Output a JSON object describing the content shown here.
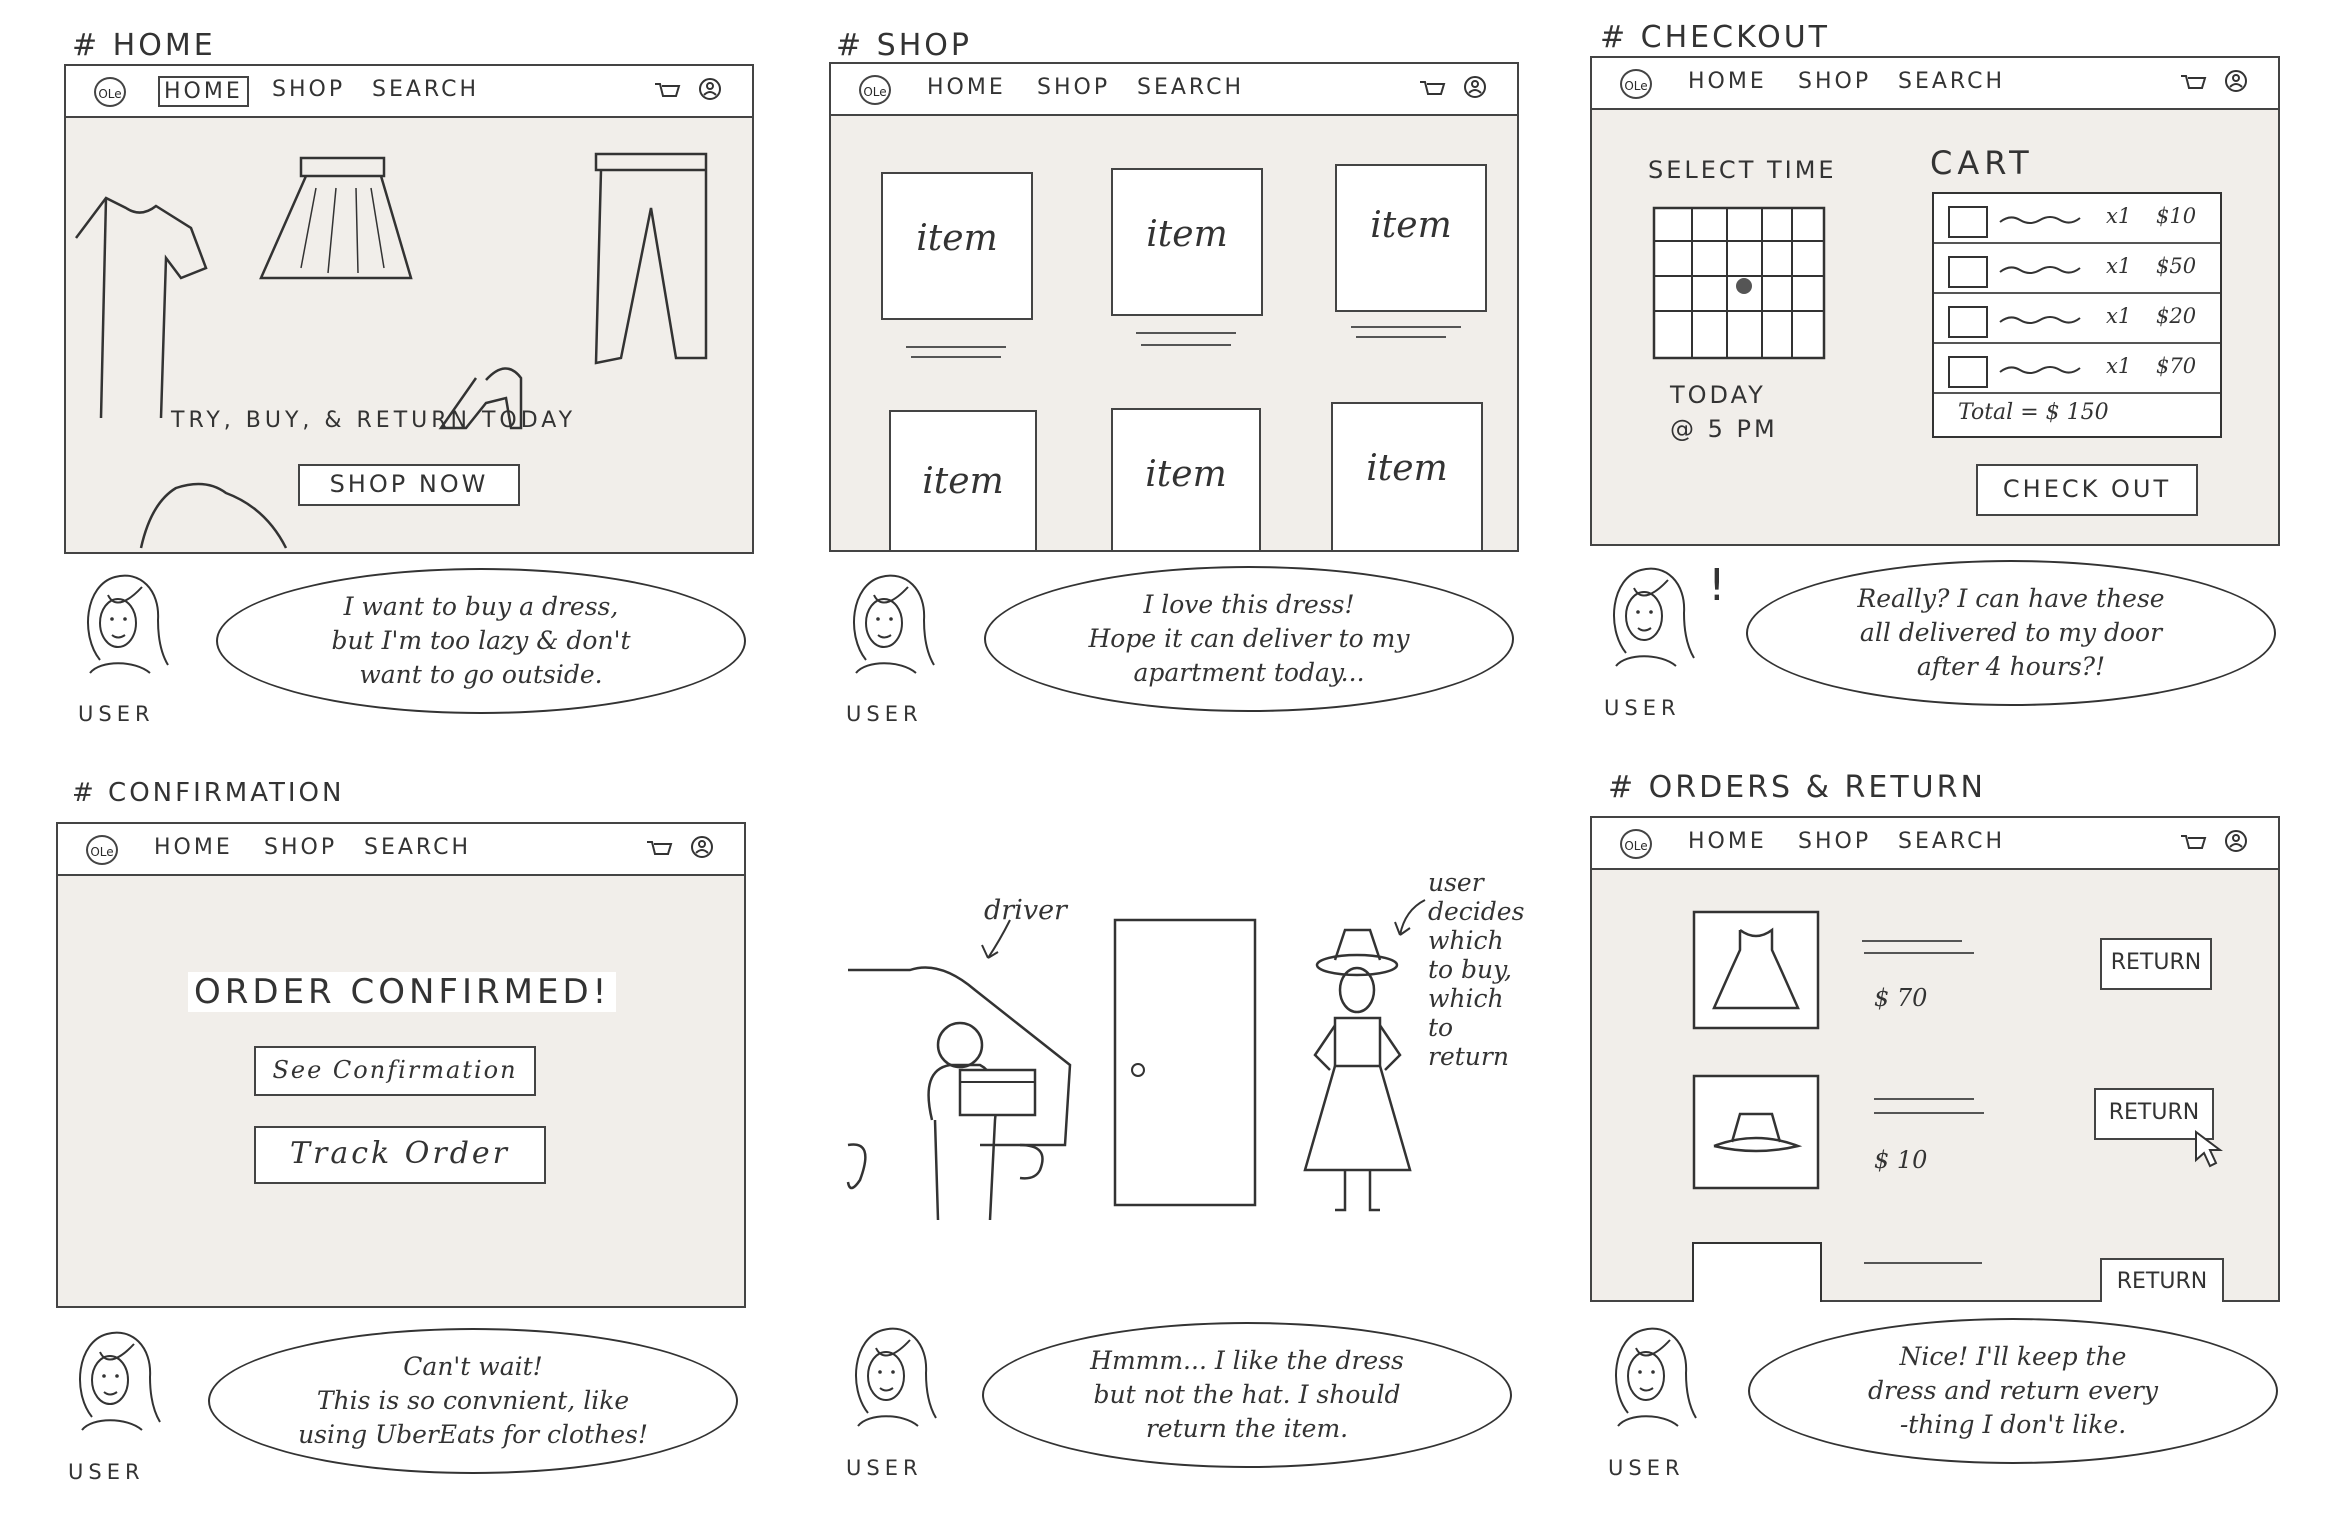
{
  "nav": {
    "logo": "OLe",
    "home": "HOME",
    "shop": "SHOP",
    "search": "SEARCH"
  },
  "user_label": "USER",
  "home": {
    "title": "# HOME",
    "tagline": "TRY, BUY, & RETURN TODAY",
    "cta": "SHOP NOW",
    "speech": "I want to buy a dress,\nbut I'm too lazy & don't\nwant to go outside."
  },
  "shop": {
    "title": "# SHOP",
    "items": [
      "item",
      "item",
      "item",
      "item",
      "item",
      "item"
    ],
    "speech": "I love this dress!\nHope it can deliver to my\napartment today..."
  },
  "checkout": {
    "title": "# CHECKOUT",
    "select_time": "SELECT TIME",
    "time_value": "TODAY\n@ 5 PM",
    "cart_title": "CART",
    "cart_items": [
      {
        "qty": "x1",
        "price": "$10"
      },
      {
        "qty": "x1",
        "price": "$50"
      },
      {
        "qty": "x1",
        "price": "$20"
      },
      {
        "qty": "x1",
        "price": "$70"
      }
    ],
    "total": "Total = $ 150",
    "button": "CHECK OUT",
    "exclaim": "!",
    "speech": "Really? I can have these\nall delivered to my door\nafter 4 hours?!"
  },
  "confirmation": {
    "title": "# CONFIRMATION",
    "heading": "ORDER CONFIRMED!",
    "see_btn": "See Confirmation",
    "track_btn": "Track Order",
    "speech": "Can't wait!\nThis is so convnient, like\nusing UberEats for clothes!"
  },
  "delivery": {
    "driver_label": "driver",
    "user_note": "user\ndecides\nwhich\nto buy,\nwhich\nto\nreturn",
    "speech": "Hmmm... I like the dress\nbut not the hat. I should\nreturn the item."
  },
  "orders": {
    "title": "# ORDERS & RETURN",
    "rows": [
      {
        "price": "$ 70",
        "button": "RETURN"
      },
      {
        "price": "$ 10",
        "button": "RETURN"
      },
      {
        "price": "",
        "button": "RETURN"
      }
    ],
    "speech": "Nice! I'll keep the\ndress and return every\n-thing I don't like."
  },
  "colors": {
    "screen_bg": "#f1eeea",
    "ink": "#333333"
  }
}
